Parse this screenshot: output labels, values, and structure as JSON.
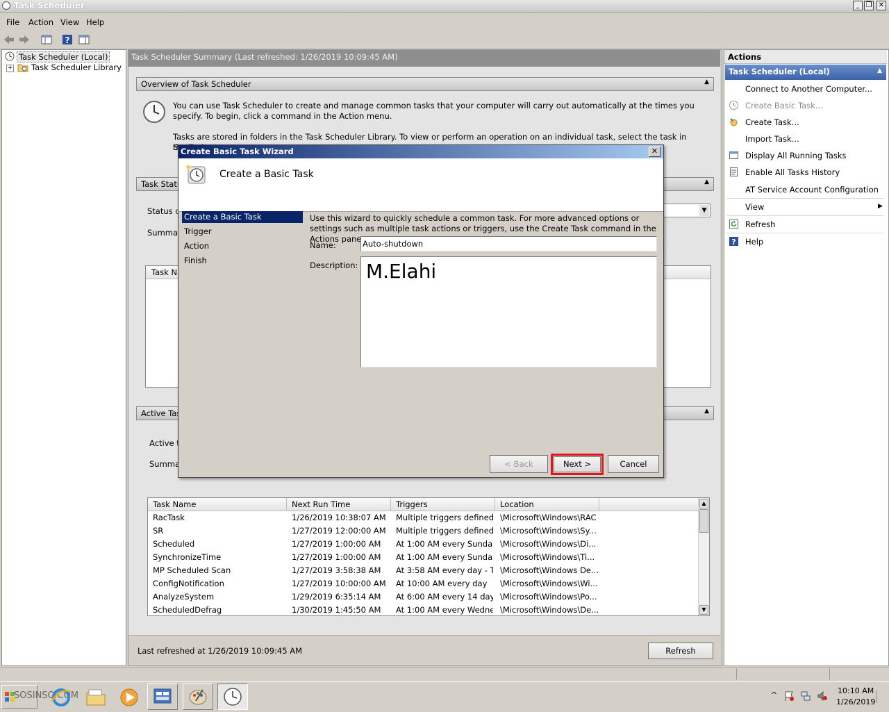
{
  "window": {
    "title": "Task Scheduler",
    "controls": [
      "_",
      "❐",
      "✕"
    ]
  },
  "menu": [
    "File",
    "Action",
    "View",
    "Help"
  ],
  "tree": {
    "root": "Task Scheduler (Local)",
    "child": "Task Scheduler Library",
    "expander": "+"
  },
  "center": {
    "header": "Task Scheduler Summary (Last refreshed: 1/26/2019 10:09:45 AM)",
    "overview_title": "Overview of Task Scheduler",
    "overview_p1": "You can use Task Scheduler to create and manage common tasks that your computer will carry out automatically at the times you specify. To begin, click a command in the Action menu.",
    "overview_p2": "Tasks are stored in folders in the Task Scheduler Library. To view or perform an operation on an individual task, select the task in the Task",
    "overview_p2_cont": "S",
    "status_title": "Task Statu",
    "status_of": "Status of",
    "summary": "Summar",
    "task_name_col": "Task Na",
    "active_title": "Active Tas",
    "active_t": "Active t",
    "active_summary": "Summa",
    "caret": "▲",
    "dropdown_arrow": "▼",
    "footer_text": "Last refreshed at 1/26/2019 10:09:45 AM",
    "refresh_button": "Refresh"
  },
  "task_table": {
    "columns": [
      "Task Name",
      "Next Run Time",
      "Triggers",
      "Location"
    ],
    "rows": [
      [
        "RacTask",
        "1/26/2019 10:38:07 AM",
        "Multiple triggers defined",
        "\\Microsoft\\Windows\\RAC"
      ],
      [
        "SR",
        "1/27/2019 12:00:00 AM",
        "Multiple triggers defined",
        "\\Microsoft\\Windows\\Sy..."
      ],
      [
        "Scheduled",
        "1/27/2019 1:00:00 AM",
        "At 1:00 AM every Sunda...",
        "\\Microsoft\\Windows\\Di..."
      ],
      [
        "SynchronizeTime",
        "1/27/2019 1:00:00 AM",
        "At 1:00 AM every Sunda...",
        "\\Microsoft\\Windows\\Ti..."
      ],
      [
        "MP Scheduled Scan",
        "1/27/2019 3:58:38 AM",
        "At 3:58 AM every day - T...",
        "\\Microsoft\\Windows De..."
      ],
      [
        "ConfigNotification",
        "1/27/2019 10:00:00 AM",
        "At 10:00 AM every day",
        "\\Microsoft\\Windows\\Wi..."
      ],
      [
        "AnalyzeSystem",
        "1/29/2019 6:35:14 AM",
        "At 6:00 AM every 14 days",
        "\\Microsoft\\Windows\\Po..."
      ],
      [
        "ScheduledDefrag",
        "1/30/2019 1:45:50 AM",
        "At 1:00 AM every Wedne...",
        "\\Microsoft\\Windows\\De..."
      ]
    ]
  },
  "actions": {
    "title": "Actions",
    "section": "Task Scheduler (Local)",
    "items": [
      "Connect to Another Computer...",
      "Create Basic Task...",
      "Create Task...",
      "Import Task...",
      "Display All Running Tasks",
      "Enable All Tasks History",
      "AT Service Account Configuration",
      "View",
      "Refresh",
      "Help"
    ],
    "submenu_arrow": "▶"
  },
  "wizard": {
    "title": "Create Basic Task Wizard",
    "close": "✕",
    "heading": "Create a Basic Task",
    "steps": [
      "Create a Basic Task",
      "Trigger",
      "Action",
      "Finish"
    ],
    "intro": "Use this wizard to quickly schedule a common task.  For more advanced options or settings such as multiple task actions or triggers, use the Create Task command in the Actions pane.",
    "name_label": "Name:",
    "name_value": "Auto-shutdown",
    "description_label": "Description:",
    "description_value": "M.Elahi",
    "back_button": "< Back",
    "next_button": "Next >",
    "cancel_button": "Cancel",
    "highlight_color": "#e0141e"
  },
  "taskbar": {
    "start_label": "SOSINSO.COM",
    "tray_arrow": "^",
    "time": "10:10 AM",
    "date": "1/26/2019"
  }
}
